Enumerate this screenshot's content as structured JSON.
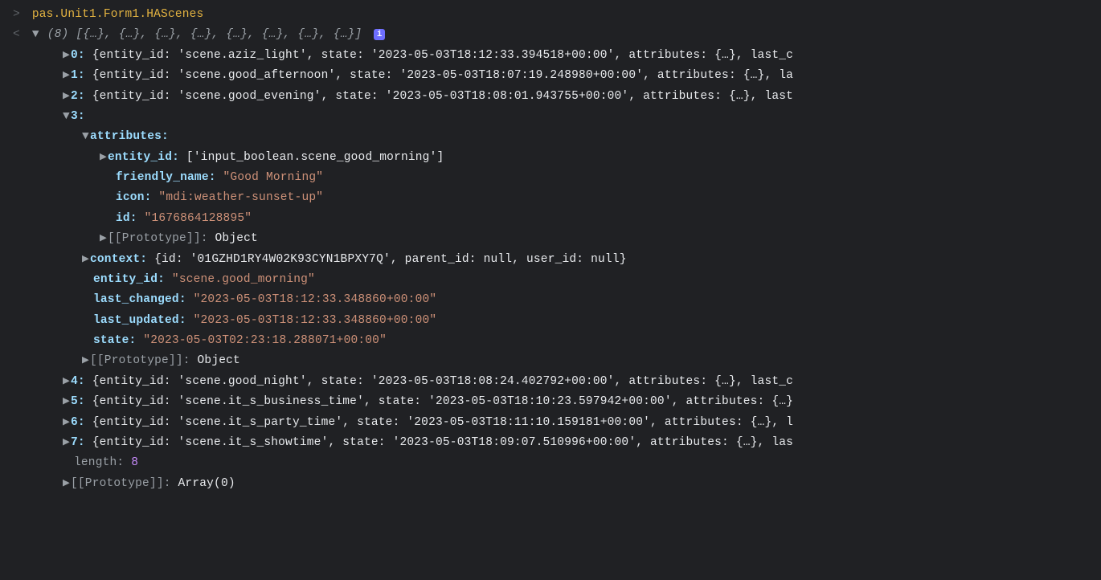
{
  "prompt_marker": ">",
  "back_marker": "<",
  "expression": "pas.Unit1.Form1.HAScenes",
  "summary_count": "(8)",
  "summary_preview": "[{…}, {…}, {…}, {…}, {…}, {…}, {…}, {…}]",
  "info_badge": "i",
  "rows": {
    "r0": {
      "idx": "0:",
      "body": "{entity_id: 'scene.aziz_light', state: '2023-05-03T18:12:33.394518+00:00', attributes: {…}, last_c"
    },
    "r1": {
      "idx": "1:",
      "body": "{entity_id: 'scene.good_afternoon', state: '2023-05-03T18:07:19.248980+00:00', attributes: {…}, la"
    },
    "r2": {
      "idx": "2:",
      "body": "{entity_id: 'scene.good_evening', state: '2023-05-03T18:08:01.943755+00:00', attributes: {…}, last"
    },
    "r3": {
      "idx": "3:"
    },
    "r4": {
      "idx": "4:",
      "body": "{entity_id: 'scene.good_night', state: '2023-05-03T18:08:24.402792+00:00', attributes: {…}, last_c"
    },
    "r5": {
      "idx": "5:",
      "body": "{entity_id: 'scene.it_s_business_time', state: '2023-05-03T18:10:23.597942+00:00', attributes: {…}"
    },
    "r6": {
      "idx": "6:",
      "body": "{entity_id: 'scene.it_s_party_time', state: '2023-05-03T18:11:10.159181+00:00', attributes: {…}, l"
    },
    "r7": {
      "idx": "7:",
      "body": "{entity_id: 'scene.it_s_showtime', state: '2023-05-03T18:09:07.510996+00:00', attributes: {…}, las"
    }
  },
  "item3": {
    "attributes_label": "attributes:",
    "entity_id_label": "entity_id:",
    "entity_id_value": "['input_boolean.scene_good_morning']",
    "friendly_name_label": "friendly_name:",
    "friendly_name_value": "\"Good Morning\"",
    "icon_label": "icon:",
    "icon_value": "\"mdi:weather-sunset-up\"",
    "id_label": "id:",
    "id_value": "\"1676864128895\"",
    "proto_label": "[[Prototype]]:",
    "proto_value": "Object",
    "context_label": "context:",
    "context_value": "{id: '01GZHD1RY4W02K93CYN1BPXY7Q', parent_id: null, user_id: null}",
    "outer_entity_id_label": "entity_id:",
    "outer_entity_id_value": "\"scene.good_morning\"",
    "last_changed_label": "last_changed:",
    "last_changed_value": "\"2023-05-03T18:12:33.348860+00:00\"",
    "last_updated_label": "last_updated:",
    "last_updated_value": "\"2023-05-03T18:12:33.348860+00:00\"",
    "state_label": "state:",
    "state_value": "\"2023-05-03T02:23:18.288071+00:00\""
  },
  "length_label": "length:",
  "length_value": "8",
  "array_proto_label": "[[Prototype]]:",
  "array_proto_value": "Array(0)",
  "glyphs": {
    "right": "▶",
    "down": "▼"
  }
}
